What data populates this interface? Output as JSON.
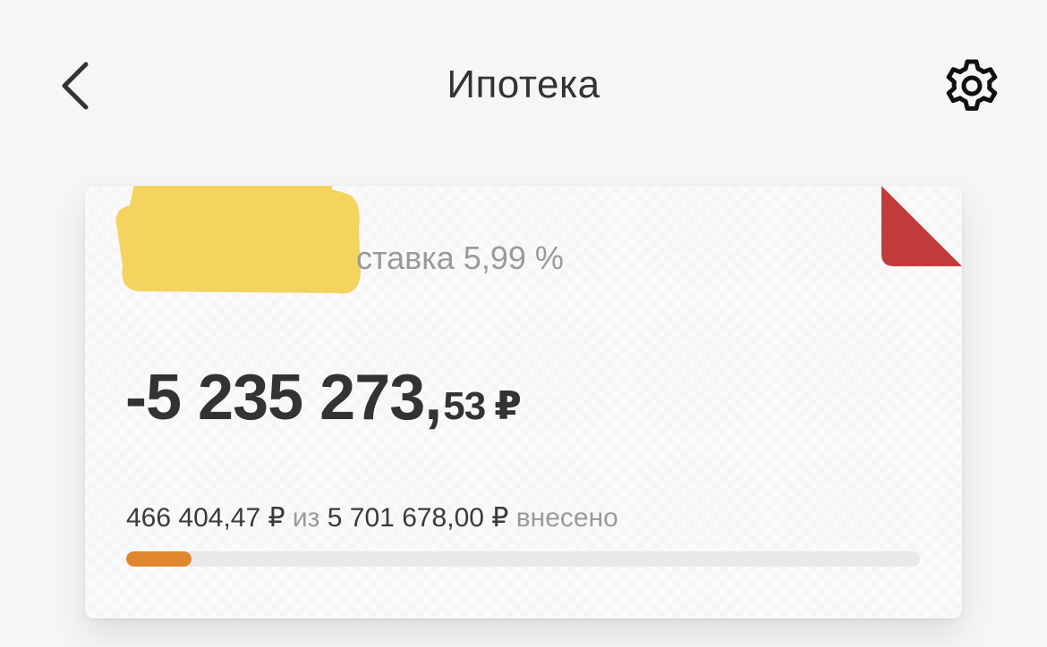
{
  "header": {
    "title": "Ипотека",
    "back_icon": "chevron-left-icon",
    "settings_icon": "gear-icon"
  },
  "card": {
    "rate_text": "ставка 5,99 %",
    "balance": {
      "main": "-5 235 273,",
      "cents": "53",
      "currency": "₽"
    },
    "paid": {
      "amount": "466 404,47 ₽",
      "of": "из",
      "total": "5 701 678,00 ₽",
      "suffix": "внесено"
    },
    "progress_fraction": 0.0818,
    "colors": {
      "progress": "#e0862d",
      "corner_flag": "#c23b3b",
      "redaction": "#f4d35e"
    }
  }
}
